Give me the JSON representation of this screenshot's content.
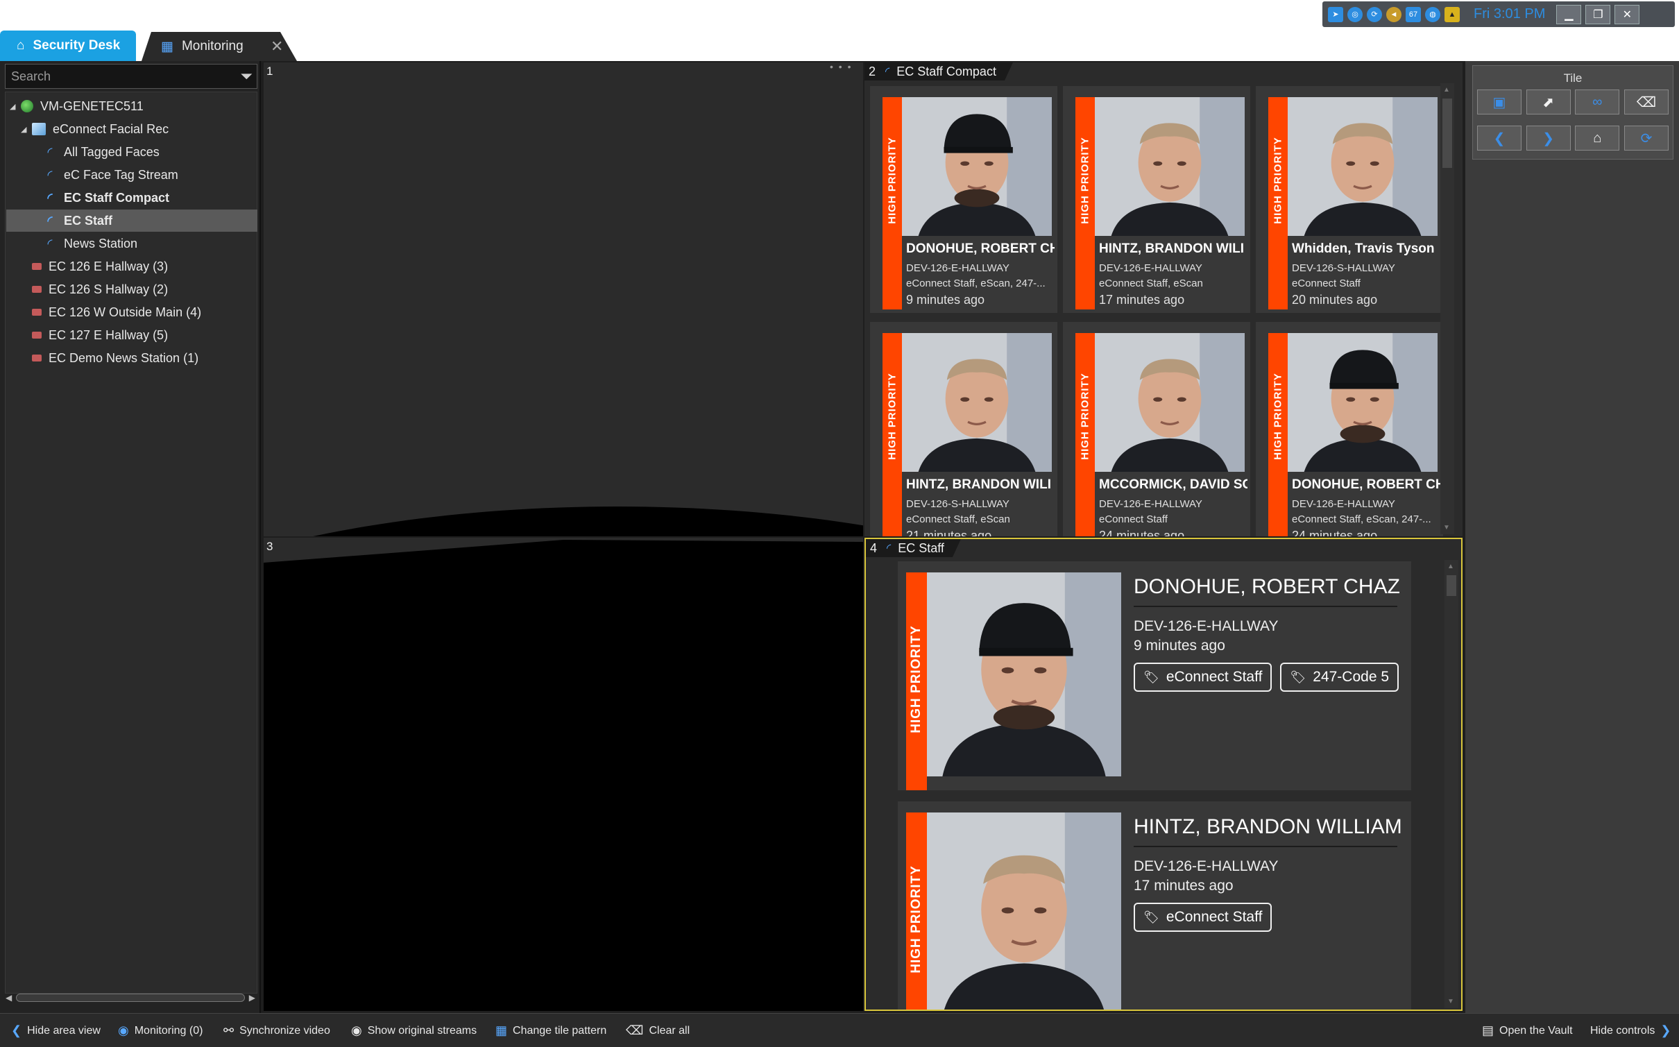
{
  "tray": {
    "time": "Fri 3:01 PM",
    "badge": "67",
    "icons": [
      "genetec-icon",
      "network-icon",
      "sync-icon",
      "volume-icon",
      "notification-icon",
      "globe-icon",
      "warning-icon"
    ]
  },
  "tabs": [
    {
      "label": "Security Desk",
      "icon": "home-icon"
    },
    {
      "label": "Monitoring",
      "icon": "monitoring-icon"
    }
  ],
  "area": {
    "search_placeholder": "Search",
    "tree": [
      {
        "label": "VM-GENETEC511",
        "icon": "globe",
        "level": 0,
        "expanded": true
      },
      {
        "label": "eConnect Facial Rec",
        "icon": "cube",
        "level": 1,
        "expanded": true
      },
      {
        "label": "All Tagged Faces",
        "icon": "stream",
        "level": 2
      },
      {
        "label": "eC Face Tag Stream",
        "icon": "stream",
        "level": 2
      },
      {
        "label": "EC Staff Compact",
        "icon": "stream",
        "level": 2,
        "bold": true
      },
      {
        "label": "EC Staff",
        "icon": "stream",
        "level": 2,
        "bold": true,
        "selected": true
      },
      {
        "label": "News Station",
        "icon": "stream",
        "level": 2
      },
      {
        "label": "EC 126 E Hallway (3)",
        "icon": "cam",
        "level": 1
      },
      {
        "label": "EC 126 S Hallway (2)",
        "icon": "cam",
        "level": 1
      },
      {
        "label": "EC 126 W Outside Main (4)",
        "icon": "cam",
        "level": 1
      },
      {
        "label": "EC 127 E Hallway (5)",
        "icon": "cam",
        "level": 1
      },
      {
        "label": "EC Demo News Station (1)",
        "icon": "cam",
        "level": 1
      }
    ]
  },
  "tiles": {
    "t1": {
      "number": "1"
    },
    "t2": {
      "number": "2",
      "title": "EC Staff Compact"
    },
    "t3": {
      "number": "3"
    },
    "t4": {
      "number": "4",
      "title": "EC Staff"
    }
  },
  "compact_cards": [
    {
      "priority": "HIGH PRIORITY",
      "name": "DONOHUE, ROBERT CH",
      "device": "DEV-126-E-HALLWAY",
      "tags": "eConnect Staff, eScan, 247-...",
      "time": "9 minutes ago",
      "cap": true
    },
    {
      "priority": "HIGH PRIORITY",
      "name": "HINTZ, BRANDON WILI",
      "device": "DEV-126-E-HALLWAY",
      "tags": "eConnect Staff, eScan",
      "time": "17 minutes ago",
      "cap": false
    },
    {
      "priority": "HIGH PRIORITY",
      "name": "Whidden, Travis Tyson",
      "device": "DEV-126-S-HALLWAY",
      "tags": "eConnect Staff",
      "time": "20 minutes ago",
      "cap": false
    },
    {
      "priority": "HIGH PRIORITY",
      "name": "HINTZ, BRANDON WILI",
      "device": "DEV-126-S-HALLWAY",
      "tags": "eConnect Staff, eScan",
      "time": "21 minutes ago",
      "cap": false
    },
    {
      "priority": "HIGH PRIORITY",
      "name": "MCCORMICK, DAVID SC",
      "device": "DEV-126-E-HALLWAY",
      "tags": "eConnect Staff",
      "time": "24 minutes ago",
      "cap": false
    },
    {
      "priority": "HIGH PRIORITY",
      "name": "DONOHUE, ROBERT CH",
      "device": "DEV-126-E-HALLWAY",
      "tags": "eConnect Staff, eScan, 247-...",
      "time": "24 minutes ago",
      "cap": true
    }
  ],
  "big_cards": [
    {
      "priority": "HIGH PRIORITY",
      "name": "DONOHUE, ROBERT CHAZ",
      "device": "DEV-126-E-HALLWAY",
      "time": "9 minutes ago",
      "tags": [
        "eConnect Staff",
        "247-Code 5"
      ],
      "cap": true
    },
    {
      "priority": "HIGH PRIORITY",
      "name": "HINTZ, BRANDON WILLIAM",
      "device": "DEV-126-E-HALLWAY",
      "time": "17 minutes ago",
      "tags": [
        "eConnect Staff"
      ],
      "cap": false
    }
  ],
  "controls": {
    "title": "Tile"
  },
  "bottom": {
    "hide_area": "Hide area view",
    "monitoring": "Monitoring (0)",
    "sync": "Synchronize video",
    "original": "Show original streams",
    "pattern": "Change tile pattern",
    "clear": "Clear all",
    "vault": "Open the Vault",
    "hide_controls": "Hide controls"
  },
  "colors": {
    "accent": "#1ba1e2",
    "priority": "#ff4500",
    "selected_tile": "#d9c63c"
  }
}
